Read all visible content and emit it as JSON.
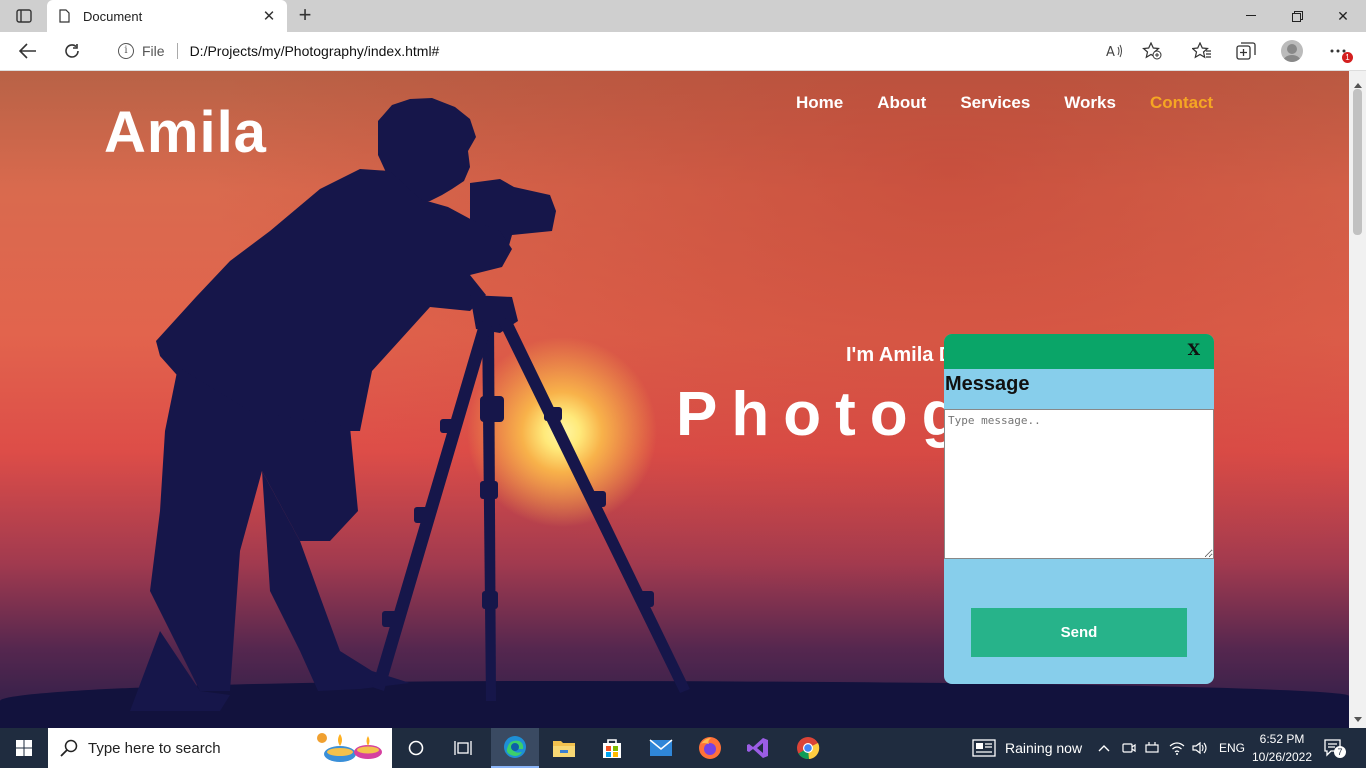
{
  "browser": {
    "tab_title": "Document",
    "url_scheme_label": "File",
    "url": "D:/Projects/my/Photography/index.html#",
    "notification_count": "1"
  },
  "site": {
    "brand": "Amila",
    "nav": [
      {
        "label": "Home"
      },
      {
        "label": "About"
      },
      {
        "label": "Services"
      },
      {
        "label": "Works"
      },
      {
        "label": "Contact",
        "active": true
      }
    ],
    "intro": "I'm Amila D",
    "headline": "Photog"
  },
  "popup": {
    "close_label": "X",
    "title": "Message",
    "placeholder": "Type message..",
    "send_label": "Send"
  },
  "taskbar": {
    "search_placeholder": "Type here to search",
    "weather": "Raining now",
    "language": "ENG",
    "time": "6:52 PM",
    "date": "10/26/2022",
    "notifications": "7"
  },
  "colors": {
    "accent_nav_active": "#f5a623",
    "popup_header": "#0aa568",
    "popup_body": "#87ceeb",
    "send_button": "#27b38a"
  }
}
